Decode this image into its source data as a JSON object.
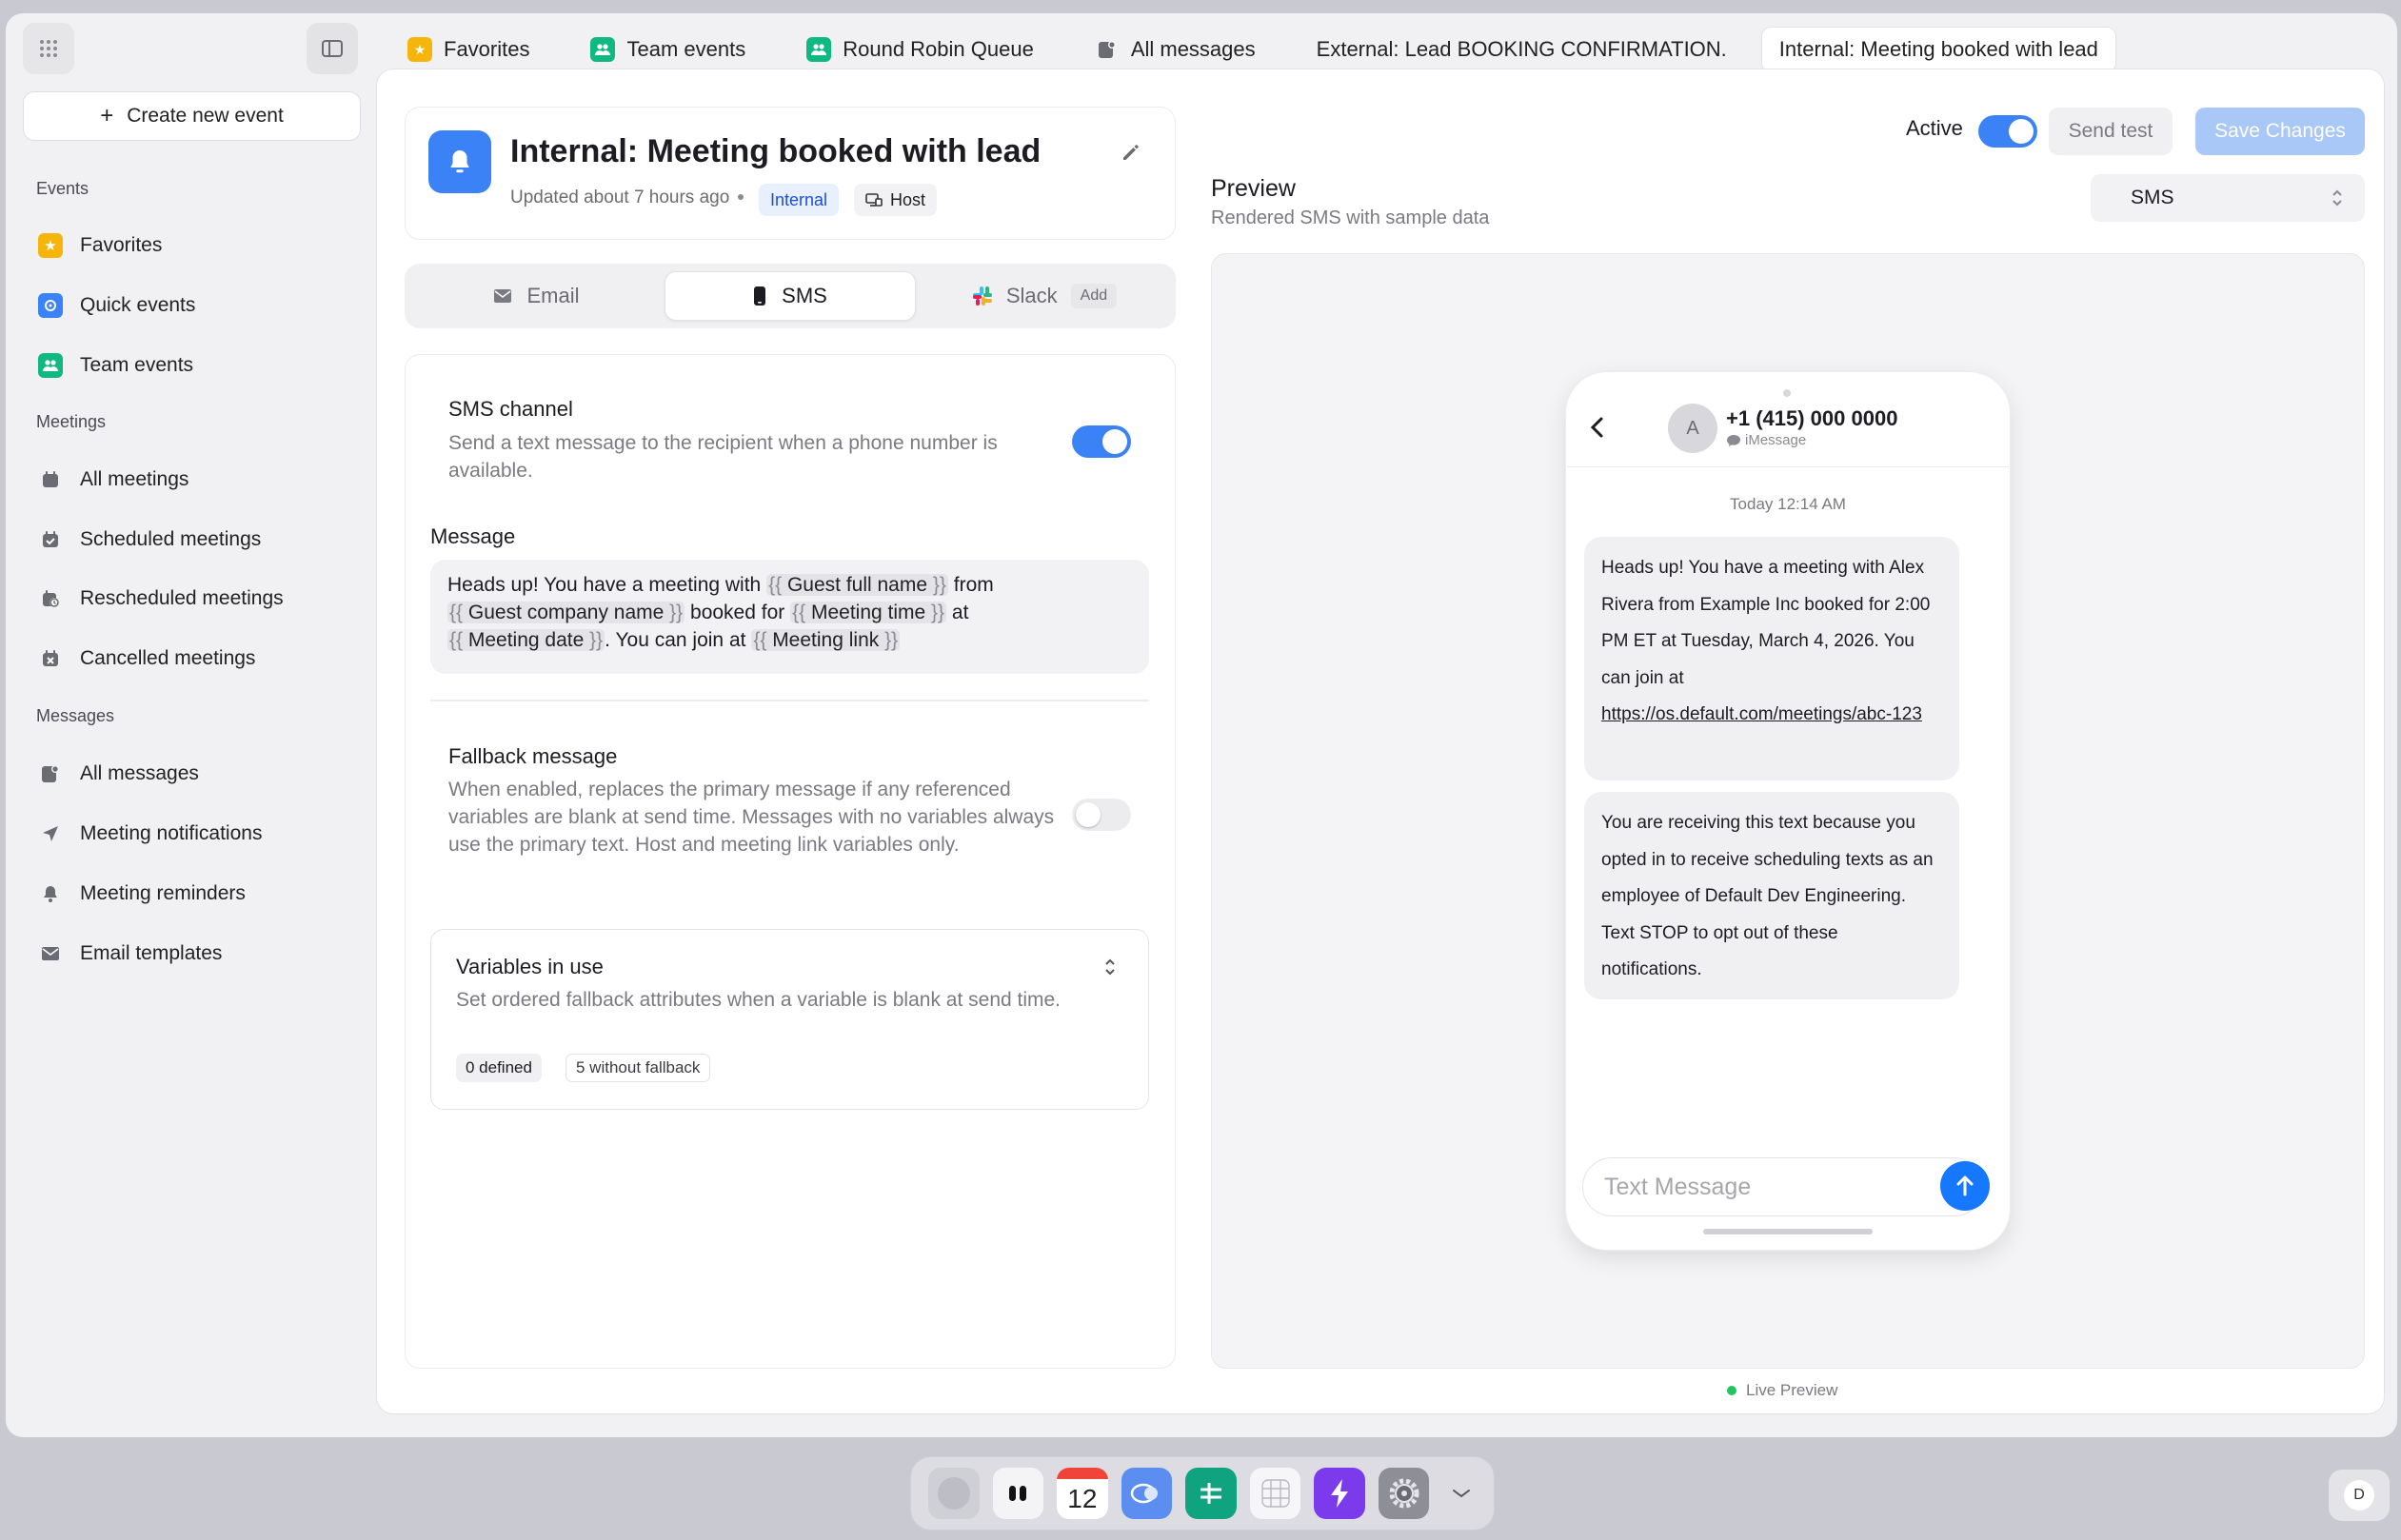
{
  "tabs": [
    {
      "label": "Favorites",
      "icon": "star-icon",
      "color": "#f5b50a"
    },
    {
      "label": "Team events",
      "icon": "team-icon",
      "color": "#10b981"
    },
    {
      "label": "Round Robin Queue",
      "icon": "team-icon",
      "color": "#10b981"
    },
    {
      "label": "All messages",
      "icon": "messages-icon",
      "color": "#6b6b73"
    },
    {
      "label": "External: Lead BOOKING CONFIRMATION.",
      "icon": "",
      "color": ""
    },
    {
      "label": "Internal: Meeting booked with lead",
      "icon": "",
      "color": "",
      "active": true
    }
  ],
  "sidebar": {
    "create_label": "Create new event",
    "sections": {
      "events": "Events",
      "meetings": "Meetings",
      "messages": "Messages"
    },
    "events": [
      {
        "label": "Favorites",
        "icon": "star-icon"
      },
      {
        "label": "Quick events",
        "icon": "quick-event-icon"
      },
      {
        "label": "Team events",
        "icon": "team-icon"
      }
    ],
    "meetings": [
      {
        "label": "All meetings",
        "icon": "calendar-icon"
      },
      {
        "label": "Scheduled meetings",
        "icon": "calendar-check-icon"
      },
      {
        "label": "Rescheduled meetings",
        "icon": "calendar-clock-icon"
      },
      {
        "label": "Cancelled meetings",
        "icon": "calendar-x-icon"
      }
    ],
    "messages": [
      {
        "label": "All messages",
        "icon": "messages-icon"
      },
      {
        "label": "Meeting notifications",
        "icon": "send-icon"
      },
      {
        "label": "Meeting reminders",
        "icon": "bell-icon"
      },
      {
        "label": "Email templates",
        "icon": "mail-icon"
      }
    ]
  },
  "header": {
    "title": "Internal: Meeting booked with lead",
    "updated": "Updated about 7 hours ago",
    "badge_internal": "Internal",
    "badge_host": "Host"
  },
  "channels": {
    "email": "Email",
    "sms": "SMS",
    "slack": "Slack",
    "slack_add": "Add",
    "selected": "SMS"
  },
  "sms_channel": {
    "label": "SMS channel",
    "desc": "Send a text message to the recipient when a phone number is available.",
    "enabled": true
  },
  "message": {
    "label": "Message",
    "parts": {
      "t1": "Heads up! You have a meeting with ",
      "v1": "Guest full name",
      "t2": " from",
      "v2": "Guest company name",
      "t3": " booked for ",
      "v3": "Meeting time",
      "t4": " at",
      "v4": "Meeting date",
      "t5": ". You can join at ",
      "v5": "Meeting link"
    }
  },
  "fallback": {
    "label": "Fallback message",
    "desc": "When enabled, replaces the primary message if any referenced variables are blank at send time. Messages with no variables always use the primary text. Host and meeting link variables only.",
    "enabled": false
  },
  "variables": {
    "title": "Variables in use",
    "desc": "Set ordered fallback attributes when a variable is blank at send time.",
    "defined": "0 defined",
    "without": "5 without fallback"
  },
  "toolbar": {
    "active_label": "Active",
    "active": true,
    "send_test": "Send test",
    "save": "Save Changes"
  },
  "preview": {
    "title": "Preview",
    "subtitle": "Rendered SMS with sample data",
    "select_value": "SMS",
    "live": "Live Preview"
  },
  "phone": {
    "avatar": "A",
    "number": "+1 (415) 000 0000",
    "service": "iMessage",
    "timestamp": "Today 12:14 AM",
    "bubble1": "Heads up! You have a meeting with Alex Rivera from Example Inc booked for 2:00 PM ET at Tuesday, March 4, 2026. You can join at ",
    "bubble1_link": "https://os.default.com/meetings/abc-123",
    "bubble2": "You are receiving this text because you opted in to receive scheduling texts as an employee of Default Dev Engineering. Text STOP to opt out of these notifications.",
    "input_placeholder": "Text Message"
  },
  "dock": {
    "calendar_day": "12"
  },
  "user_initial": "D",
  "colors": {
    "accent": "#3b82f6",
    "save_disabled": "#a9c8f7",
    "send_button": "#1677ff",
    "live_dot": "#22c55e"
  }
}
